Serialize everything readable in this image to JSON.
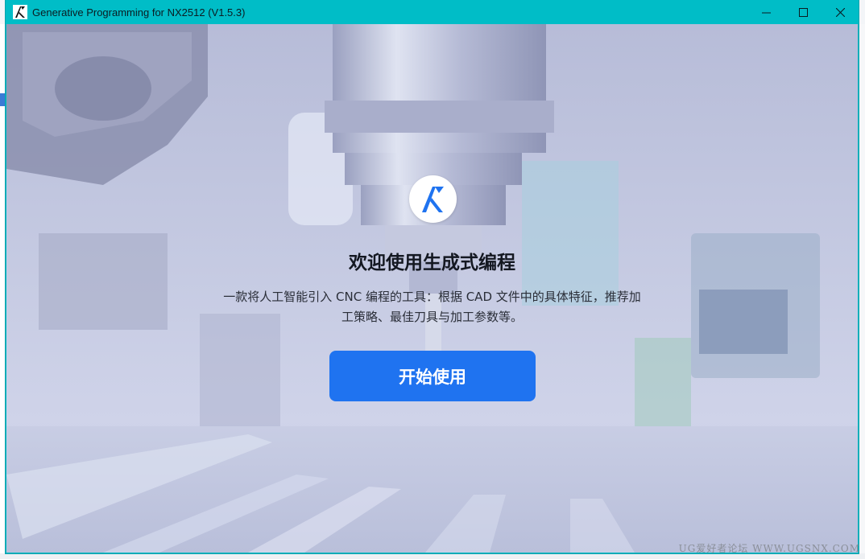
{
  "window": {
    "title": "Generative Programming for NX2512 (V1.5.3)",
    "app_icon": "nx-logo-icon",
    "controls": {
      "minimize": "—",
      "maximize": "☐",
      "close": "✕"
    },
    "title_color": "#00bdc7"
  },
  "hero": {
    "logo_icon": "generative-programming-logo-icon",
    "title": "欢迎使用生成式编程",
    "description": "一款将人工智能引入 CNC 编程的工具：根据 CAD 文件中的具体特征，推荐加工策略、最佳刀具与加工参数等。",
    "start_button": "开始使用",
    "accent_color": "#1f73f0"
  },
  "watermark": "UG爱好者论坛 WWW.UGSNX.COM"
}
